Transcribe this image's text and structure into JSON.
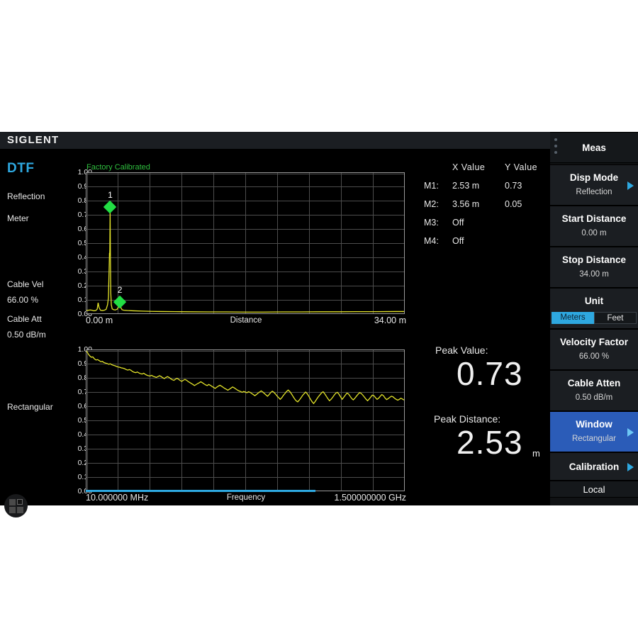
{
  "brand": "SIGLENT",
  "left_panel": {
    "mode": "DTF",
    "display_mode": "Reflection",
    "unit": "Meter",
    "cable_vel_label": "Cable Vel",
    "cable_vel_value": "66.00 %",
    "cable_att_label": "Cable Att",
    "cable_att_value": "0.50 dB/m",
    "window": "Rectangular",
    "app_launcher_icon": "grid-apps-icon"
  },
  "calibration_status": "Factory Calibrated",
  "marker_table": {
    "x_header": "X  Value",
    "y_header": "Y  Value",
    "rows": [
      {
        "id": "M1:",
        "x": "2.53 m",
        "y": "0.73"
      },
      {
        "id": "M2:",
        "x": "3.56 m",
        "y": "0.05"
      },
      {
        "id": "M3:",
        "x": "Off",
        "y": ""
      },
      {
        "id": "M4:",
        "x": "Off",
        "y": ""
      }
    ]
  },
  "readouts": {
    "peak_value_label": "Peak Value:",
    "peak_value": "0.73",
    "peak_distance_label": "Peak Distance:",
    "peak_distance": "2.53",
    "peak_distance_unit": "m"
  },
  "menu": {
    "header": "Meas",
    "items": [
      {
        "title": "Disp Mode",
        "sub": "Reflection",
        "arrow": true,
        "selected": false
      },
      {
        "title": "Start Distance",
        "sub": "0.00 m",
        "arrow": false,
        "selected": false
      },
      {
        "title": "Stop Distance",
        "sub": "34.00 m",
        "arrow": false,
        "selected": false
      },
      {
        "title": "Unit",
        "sub": "",
        "arrow": false,
        "selected": false,
        "segments": [
          "Meters",
          "Feet"
        ],
        "segment_active": 0
      },
      {
        "title": "Velocity Factor",
        "sub": "66.00 %",
        "arrow": false,
        "selected": false
      },
      {
        "title": "Cable Atten",
        "sub": "0.50 dB/m",
        "arrow": false,
        "selected": false
      },
      {
        "title": "Window",
        "sub": "Rectangular",
        "arrow": true,
        "selected": true
      },
      {
        "title": "Calibration",
        "sub": "",
        "arrow": true,
        "selected": false
      },
      {
        "title": "Local",
        "sub": "",
        "arrow": false,
        "selected": false
      }
    ]
  },
  "colors": {
    "accent": "#2ea8e0",
    "trace": "#e5e52a",
    "marker": "#22dd44",
    "selected_menu": "#2b5cb8",
    "calibrated": "#2fbf3f"
  },
  "chart_data": [
    {
      "type": "line",
      "name": "dtf-distance-chart",
      "title": "",
      "xlabel": "Distance",
      "ylabel": "",
      "xlim": [
        0,
        34
      ],
      "ylim": [
        0,
        1.0
      ],
      "x_tick_left": "0.00 m",
      "x_tick_right": "34.00 m",
      "grid": true,
      "y_ticks": [
        "1.00",
        "0.90",
        "0.80",
        "0.70",
        "0.60",
        "0.50",
        "0.40",
        "0.30",
        "0.20",
        "0.10",
        "0.00"
      ],
      "markers": [
        {
          "label": "1",
          "x": 2.53,
          "y": 0.76
        },
        {
          "label": "2",
          "x": 3.56,
          "y": 0.09
        }
      ],
      "points": [
        [
          0.0,
          0.02
        ],
        [
          0.2,
          0.022
        ],
        [
          0.4,
          0.024
        ],
        [
          0.6,
          0.022
        ],
        [
          0.8,
          0.018
        ],
        [
          1.0,
          0.02
        ],
        [
          1.15,
          0.03
        ],
        [
          1.25,
          0.075
        ],
        [
          1.35,
          0.04
        ],
        [
          1.5,
          0.022
        ],
        [
          1.7,
          0.02
        ],
        [
          1.9,
          0.022
        ],
        [
          2.1,
          0.028
        ],
        [
          2.25,
          0.06
        ],
        [
          2.35,
          0.11
        ],
        [
          2.42,
          0.3
        ],
        [
          2.46,
          0.43
        ],
        [
          2.48,
          0.41
        ],
        [
          2.5,
          0.455
        ],
        [
          2.53,
          0.735
        ],
        [
          2.56,
          0.42
        ],
        [
          2.6,
          0.15
        ],
        [
          2.66,
          0.06
        ],
        [
          2.75,
          0.032
        ],
        [
          2.9,
          0.026
        ],
        [
          3.1,
          0.024
        ],
        [
          3.3,
          0.03
        ],
        [
          3.45,
          0.05
        ],
        [
          3.56,
          0.085
        ],
        [
          3.66,
          0.045
        ],
        [
          3.8,
          0.026
        ],
        [
          4.0,
          0.022
        ],
        [
          4.4,
          0.02
        ],
        [
          5.0,
          0.018
        ],
        [
          6.0,
          0.016
        ],
        [
          7.0,
          0.014
        ],
        [
          8.0,
          0.013
        ],
        [
          9.5,
          0.012
        ],
        [
          11.0,
          0.011
        ],
        [
          13.0,
          0.01
        ],
        [
          15.0,
          0.01
        ],
        [
          17.0,
          0.009
        ],
        [
          19.0,
          0.009
        ],
        [
          21.0,
          0.01
        ],
        [
          23.0,
          0.01
        ],
        [
          25.0,
          0.011
        ],
        [
          27.0,
          0.011
        ],
        [
          29.0,
          0.012
        ],
        [
          31.0,
          0.012
        ],
        [
          33.0,
          0.013
        ],
        [
          34.0,
          0.013
        ]
      ]
    },
    {
      "type": "line",
      "name": "return-loss-frequency-chart",
      "title": "",
      "xlabel": "Frequency",
      "ylabel": "",
      "xlim": [
        10,
        1500
      ],
      "ylim": [
        0,
        1.0
      ],
      "x_tick_left": "10.000000 MHz",
      "x_tick_right": "1.500000000 GHz",
      "grid": true,
      "y_ticks": [
        "1.00",
        "0.90",
        "0.80",
        "0.70",
        "0.60",
        "0.50",
        "0.40",
        "0.30",
        "0.20",
        "0.10",
        "0.00"
      ],
      "sweep_progress_pct": 72,
      "points": [
        [
          0,
          0.995
        ],
        [
          1,
          0.975
        ],
        [
          2,
          0.96
        ],
        [
          3,
          0.95
        ],
        [
          4,
          0.952
        ],
        [
          5,
          0.938
        ],
        [
          6,
          0.93
        ],
        [
          7,
          0.933
        ],
        [
          8,
          0.926
        ],
        [
          9,
          0.918
        ],
        [
          10,
          0.92
        ],
        [
          11,
          0.912
        ],
        [
          12,
          0.908
        ],
        [
          13,
          0.905
        ],
        [
          14,
          0.9
        ],
        [
          15,
          0.903
        ],
        [
          16,
          0.896
        ],
        [
          17,
          0.892
        ],
        [
          18,
          0.889
        ],
        [
          19,
          0.884
        ],
        [
          20,
          0.88
        ],
        [
          21,
          0.878
        ],
        [
          22,
          0.874
        ],
        [
          23,
          0.872
        ],
        [
          24,
          0.868
        ],
        [
          25,
          0.862
        ],
        [
          26,
          0.858
        ],
        [
          27,
          0.862
        ],
        [
          28,
          0.857
        ],
        [
          29,
          0.848
        ],
        [
          30,
          0.843
        ],
        [
          31,
          0.84
        ],
        [
          32,
          0.845
        ],
        [
          33,
          0.838
        ],
        [
          34,
          0.833
        ],
        [
          35,
          0.83
        ],
        [
          36,
          0.836
        ],
        [
          37,
          0.828
        ],
        [
          38,
          0.822
        ],
        [
          39,
          0.818
        ],
        [
          40,
          0.816
        ],
        [
          41,
          0.821
        ],
        [
          42,
          0.814
        ],
        [
          43,
          0.81
        ],
        [
          44,
          0.806
        ],
        [
          45,
          0.812
        ],
        [
          46,
          0.818
        ],
        [
          47,
          0.812
        ],
        [
          48,
          0.804
        ],
        [
          49,
          0.798
        ],
        [
          50,
          0.806
        ],
        [
          51,
          0.812
        ],
        [
          52,
          0.806
        ],
        [
          53,
          0.797
        ],
        [
          54,
          0.79
        ],
        [
          55,
          0.785
        ],
        [
          56,
          0.793
        ],
        [
          57,
          0.8
        ],
        [
          58,
          0.793
        ],
        [
          59,
          0.784
        ],
        [
          60,
          0.778
        ],
        [
          61,
          0.786
        ],
        [
          62,
          0.792
        ],
        [
          63,
          0.786
        ],
        [
          64,
          0.777
        ],
        [
          65,
          0.77
        ],
        [
          66,
          0.763
        ],
        [
          67,
          0.756
        ],
        [
          68,
          0.748
        ],
        [
          69,
          0.755
        ],
        [
          70,
          0.762
        ],
        [
          71,
          0.768
        ],
        [
          72,
          0.775
        ],
        [
          73,
          0.768
        ],
        [
          74,
          0.76
        ],
        [
          75,
          0.753
        ],
        [
          76,
          0.748
        ],
        [
          77,
          0.756
        ],
        [
          78,
          0.75
        ],
        [
          79,
          0.742
        ],
        [
          80,
          0.735
        ],
        [
          81,
          0.728
        ],
        [
          82,
          0.736
        ],
        [
          83,
          0.744
        ],
        [
          84,
          0.75
        ],
        [
          85,
          0.744
        ],
        [
          86,
          0.736
        ],
        [
          87,
          0.728
        ],
        [
          88,
          0.722
        ],
        [
          89,
          0.715
        ],
        [
          90,
          0.722
        ],
        [
          91,
          0.73
        ],
        [
          92,
          0.738
        ],
        [
          93,
          0.732
        ],
        [
          94,
          0.724
        ],
        [
          95,
          0.716
        ],
        [
          96,
          0.71
        ],
        [
          97,
          0.706
        ],
        [
          98,
          0.7
        ],
        [
          99,
          0.706
        ],
        [
          100,
          0.702
        ],
        [
          101,
          0.697
        ],
        [
          102,
          0.704
        ],
        [
          103,
          0.7
        ],
        [
          104,
          0.692
        ],
        [
          105,
          0.684
        ],
        [
          106,
          0.676
        ],
        [
          107,
          0.684
        ],
        [
          108,
          0.694
        ],
        [
          109,
          0.702
        ],
        [
          110,
          0.71
        ],
        [
          111,
          0.702
        ],
        [
          112,
          0.692
        ],
        [
          113,
          0.682
        ],
        [
          114,
          0.672
        ],
        [
          115,
          0.684
        ],
        [
          116,
          0.698
        ],
        [
          117,
          0.708
        ],
        [
          118,
          0.7
        ],
        [
          119,
          0.688
        ],
        [
          120,
          0.674
        ],
        [
          121,
          0.662
        ],
        [
          122,
          0.65
        ],
        [
          123,
          0.662
        ],
        [
          124,
          0.678
        ],
        [
          125,
          0.692
        ],
        [
          126,
          0.706
        ],
        [
          127,
          0.716
        ],
        [
          128,
          0.706
        ],
        [
          129,
          0.69
        ],
        [
          130,
          0.672
        ],
        [
          131,
          0.654
        ],
        [
          132,
          0.64
        ],
        [
          133,
          0.632
        ],
        [
          134,
          0.644
        ],
        [
          135,
          0.66
        ],
        [
          136,
          0.676
        ],
        [
          137,
          0.69
        ],
        [
          138,
          0.702
        ],
        [
          139,
          0.69
        ],
        [
          140,
          0.672
        ],
        [
          141,
          0.652
        ],
        [
          142,
          0.634
        ],
        [
          143,
          0.62
        ],
        [
          144,
          0.634
        ],
        [
          145,
          0.652
        ],
        [
          146,
          0.668
        ],
        [
          147,
          0.682
        ],
        [
          148,
          0.696
        ],
        [
          149,
          0.704
        ],
        [
          150,
          0.69
        ],
        [
          151,
          0.672
        ],
        [
          152,
          0.655
        ],
        [
          153,
          0.64
        ],
        [
          154,
          0.65
        ],
        [
          155,
          0.664
        ],
        [
          156,
          0.68
        ],
        [
          157,
          0.694
        ],
        [
          158,
          0.7
        ],
        [
          159,
          0.686
        ],
        [
          160,
          0.668
        ],
        [
          161,
          0.65
        ],
        [
          162,
          0.664
        ],
        [
          163,
          0.68
        ],
        [
          164,
          0.694
        ],
        [
          165,
          0.688
        ],
        [
          166,
          0.672
        ],
        [
          167,
          0.656
        ],
        [
          168,
          0.646
        ],
        [
          169,
          0.658
        ],
        [
          170,
          0.672
        ],
        [
          171,
          0.686
        ],
        [
          172,
          0.698
        ],
        [
          173,
          0.692
        ],
        [
          174,
          0.68
        ],
        [
          175,
          0.666
        ],
        [
          176,
          0.652
        ],
        [
          177,
          0.64
        ],
        [
          178,
          0.652
        ],
        [
          179,
          0.666
        ],
        [
          180,
          0.68
        ],
        [
          181,
          0.676
        ],
        [
          182,
          0.662
        ],
        [
          183,
          0.65
        ],
        [
          184,
          0.658
        ],
        [
          185,
          0.672
        ],
        [
          186,
          0.684
        ],
        [
          187,
          0.676
        ],
        [
          188,
          0.66
        ],
        [
          189,
          0.648
        ],
        [
          190,
          0.655
        ],
        [
          191,
          0.664
        ],
        [
          192,
          0.672
        ],
        [
          193,
          0.668
        ],
        [
          194,
          0.658
        ],
        [
          195,
          0.65
        ],
        [
          196,
          0.644
        ],
        [
          197,
          0.65
        ],
        [
          198,
          0.658
        ],
        [
          199,
          0.652
        ],
        [
          200,
          0.645
        ]
      ]
    }
  ]
}
